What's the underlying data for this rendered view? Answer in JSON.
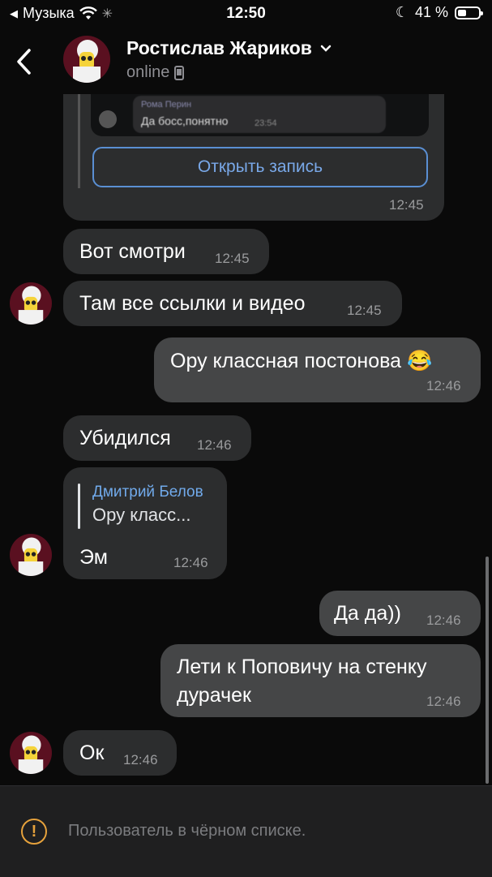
{
  "status_bar": {
    "back_app": "Музыка",
    "time": "12:50",
    "battery": "41 %",
    "battery_level": 0.41
  },
  "header": {
    "name": "Ростислав Жариков",
    "status": "online"
  },
  "messages": {
    "shared_post": {
      "preview_author": "Рома Перин",
      "preview_text": "Да босс,понятно",
      "preview_time": "23:54",
      "button": "Открыть запись",
      "time": "12:45"
    },
    "m1": {
      "text": "Вот смотри",
      "time": "12:45"
    },
    "m2": {
      "text": "Там все ссылки и видео",
      "time": "12:45"
    },
    "m3": {
      "text": "Ору классная постонова 😂",
      "time": "12:46"
    },
    "m4": {
      "text": "Убидился",
      "time": "12:46"
    },
    "m5": {
      "reply_name": "Дмитрий Белов",
      "reply_text": "Ору класс...",
      "text": "Эм",
      "time": "12:46"
    },
    "m6": {
      "text": "Да да))",
      "time": "12:46"
    },
    "m7": {
      "line1": "Лети к Поповичу на стенку",
      "line2": "дурачек",
      "time": "12:46"
    },
    "m8": {
      "text": "Ок",
      "time": "12:46"
    }
  },
  "footer": {
    "blocked_text": "Пользователь в чёрном списке."
  },
  "colors": {
    "background": "#0a0a0a",
    "incoming_bubble": "#2c2d2e",
    "outgoing_bubble": "#454647",
    "link": "#71aaeb",
    "warning": "#e6a23c"
  }
}
